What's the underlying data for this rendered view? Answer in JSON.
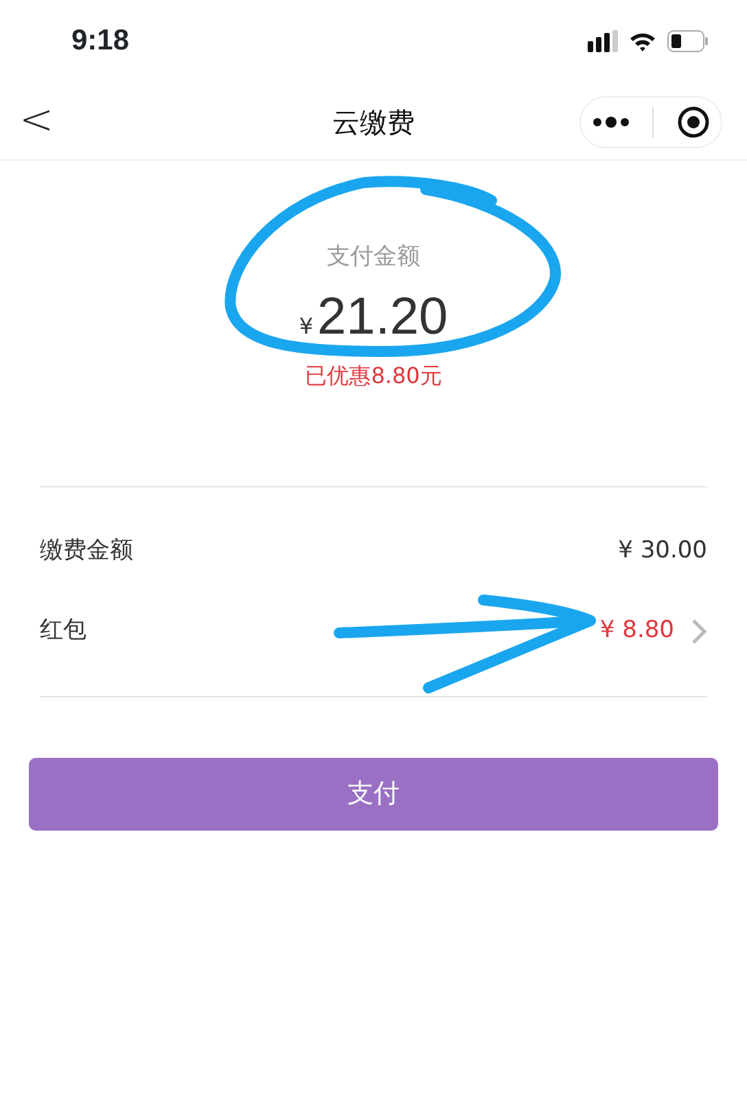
{
  "status_bar": {
    "time": "9:18"
  },
  "nav": {
    "back": "<",
    "title": "云缴费"
  },
  "summary": {
    "label": "支付金额",
    "currency": "¥",
    "amount": "21.20",
    "discount": "已优惠8.80元"
  },
  "rows": [
    {
      "kind": "plain",
      "label": "缴费金额",
      "value": "¥ 30.00"
    },
    {
      "kind": "link",
      "label": "红包",
      "value": "¥ 8.80"
    }
  ],
  "pay_button": "支付"
}
